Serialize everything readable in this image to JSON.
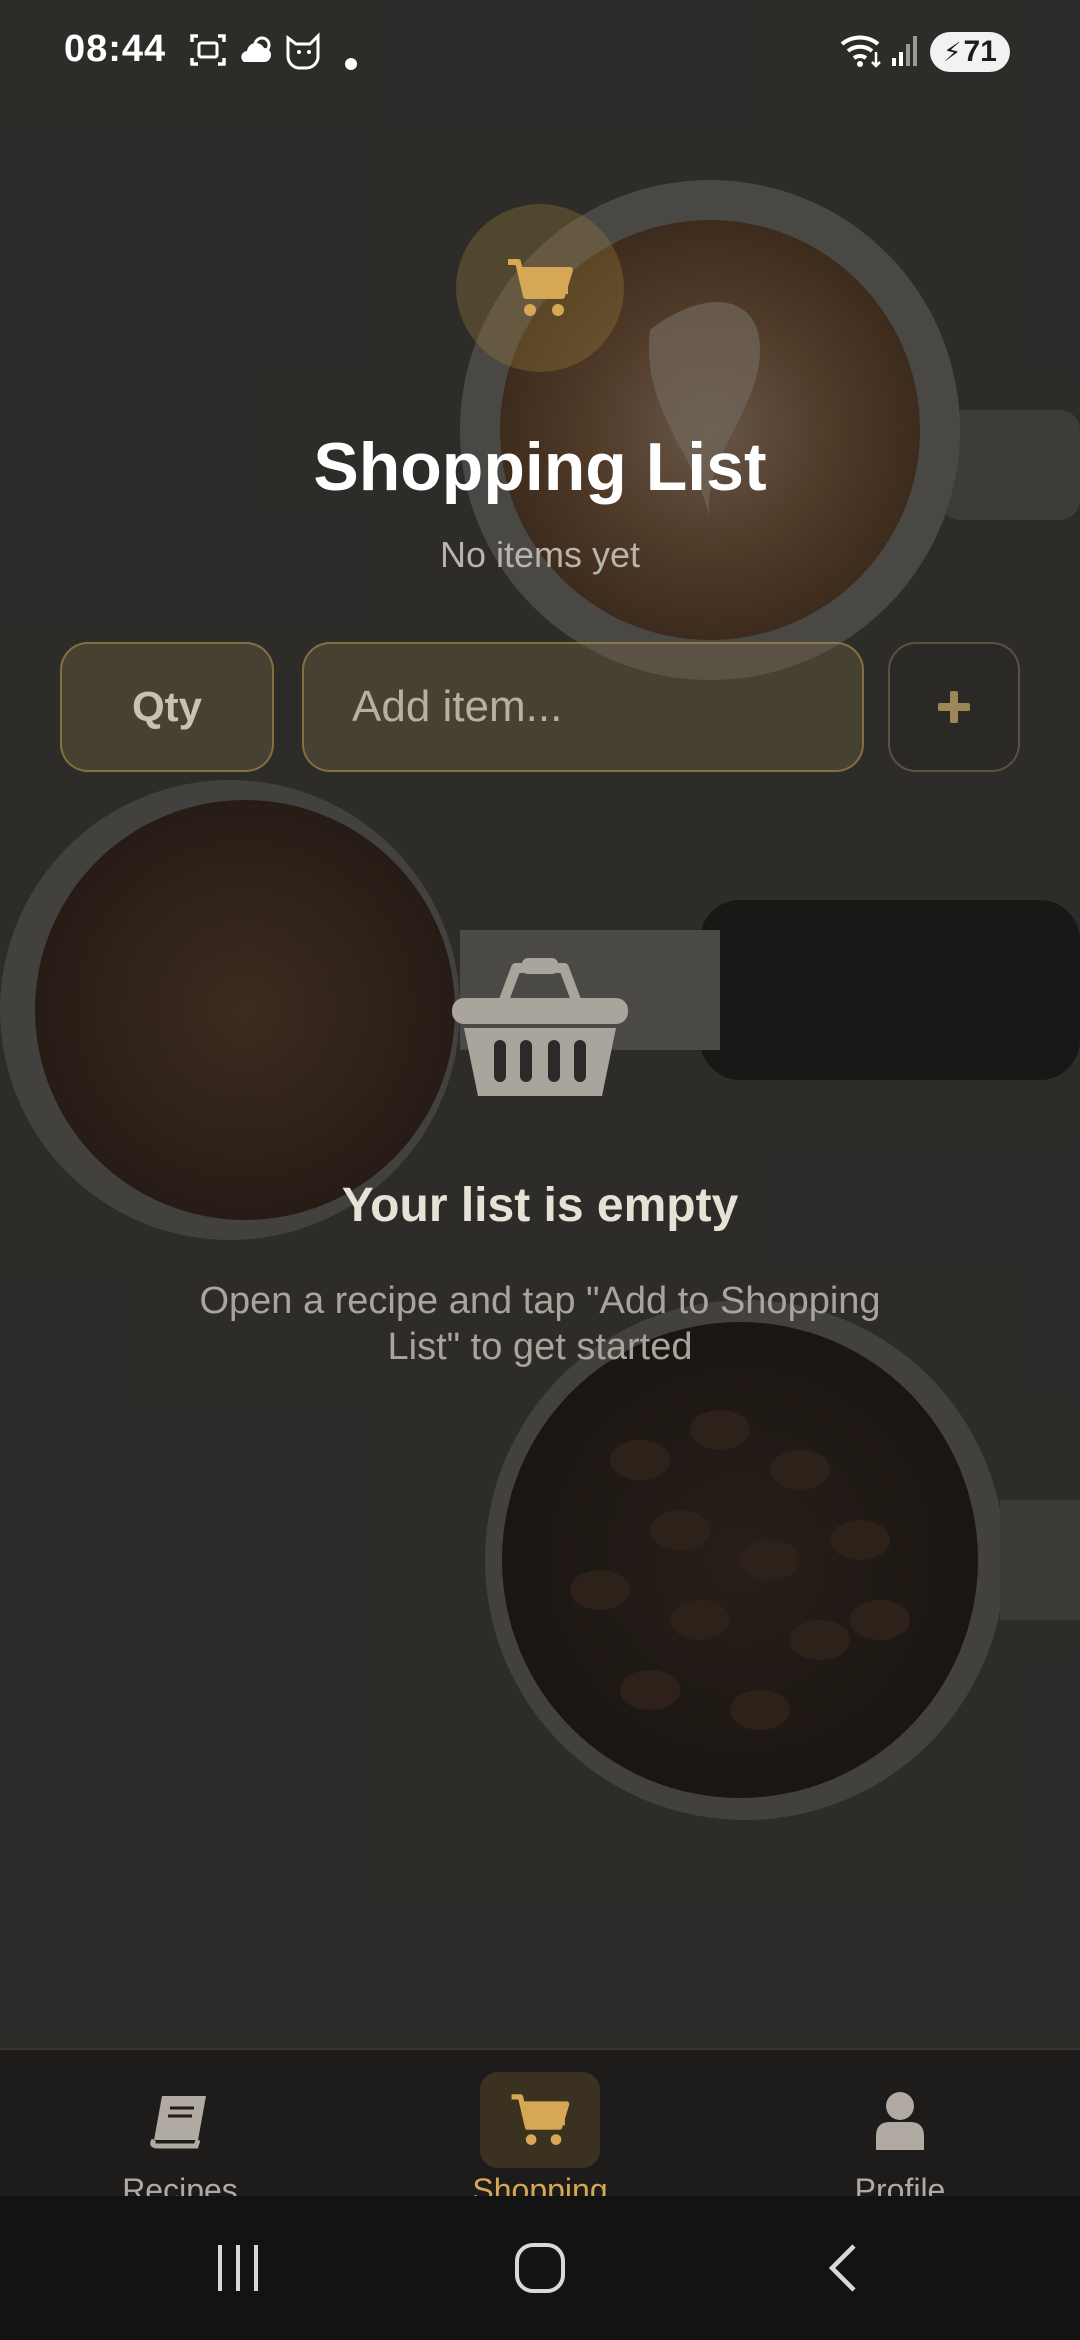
{
  "status_bar": {
    "time": "08:44",
    "battery": "71",
    "icons": [
      "screenshot-icon",
      "weather-icon",
      "cat-app-icon",
      "notification-dot-icon",
      "wifi-icon",
      "signal-icon",
      "battery-icon"
    ]
  },
  "header": {
    "icon": "cart-icon",
    "title": "Shopping List",
    "subtitle": "No items yet"
  },
  "input_row": {
    "qty_label": "Qty",
    "item_placeholder": "Add item...",
    "item_value": "",
    "add_button_label": "+"
  },
  "empty_state": {
    "icon": "basket-icon",
    "title": "Your list is empty",
    "description": "Open a recipe and tap \"Add to Shopping List\" to get started"
  },
  "bottom_nav": {
    "items": [
      {
        "label": "Recipes",
        "icon": "book-icon",
        "active": false
      },
      {
        "label": "Shopping",
        "icon": "cart-icon",
        "active": true
      },
      {
        "label": "Profile",
        "icon": "person-icon",
        "active": false
      }
    ]
  },
  "system_nav": [
    "recent-apps-icon",
    "home-icon",
    "back-icon"
  ],
  "colors": {
    "accent": "#d6a754",
    "background": "#222120",
    "nav_background": "#1d1c1b"
  }
}
